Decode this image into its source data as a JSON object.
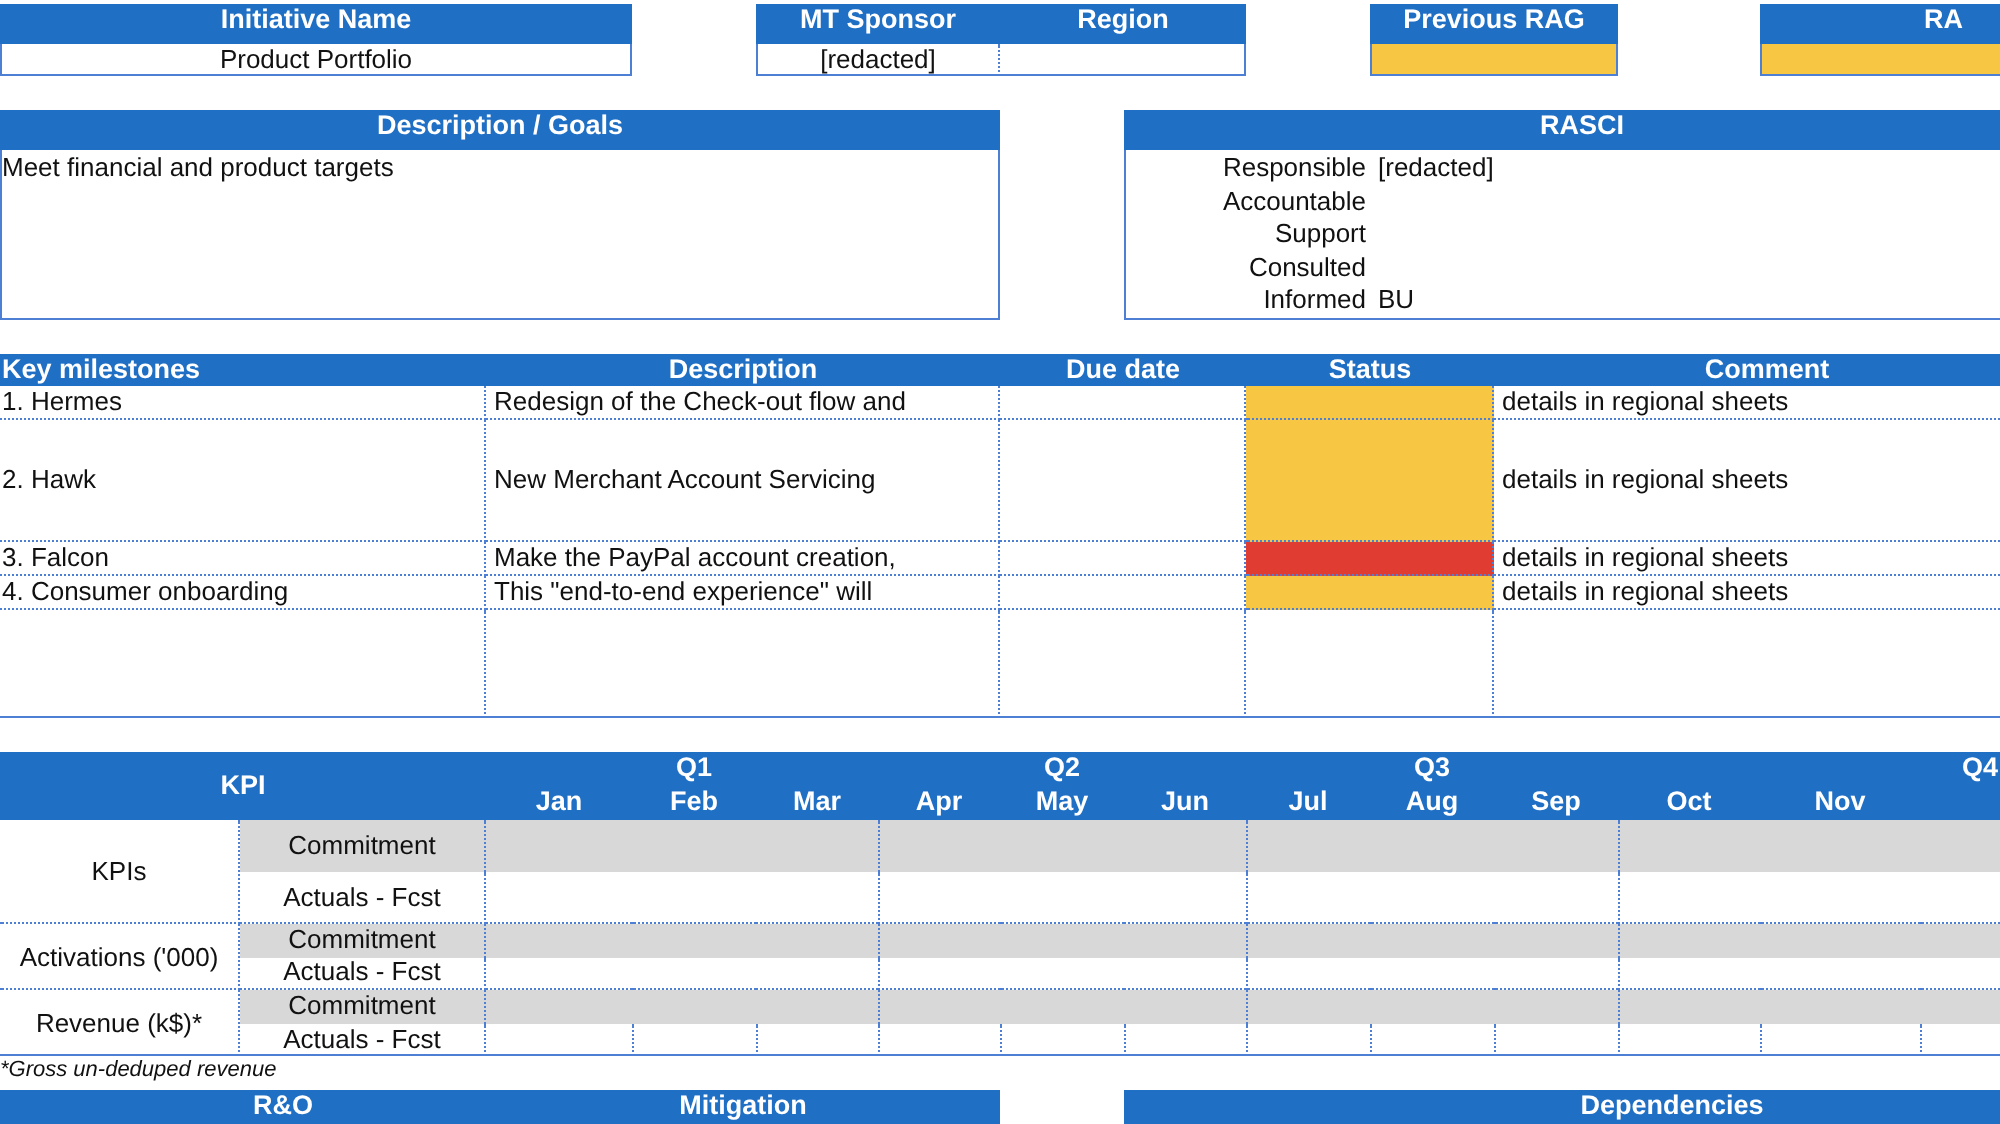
{
  "summary": {
    "initiative": {
      "header": "Initiative Name",
      "value": "Product Portfolio"
    },
    "sponsor": {
      "header": "MT Sponsor",
      "value": "[redacted]"
    },
    "region": {
      "header": "Region"
    },
    "previous_rag": {
      "header": "Previous RAG",
      "color": "#f7c744"
    },
    "rag": {
      "header": "RA",
      "color": "#f7c744"
    }
  },
  "description": {
    "header": "Description / Goals",
    "text": "Meet financial and product targets"
  },
  "rasci": {
    "header": "RASCI",
    "rows": [
      {
        "role": "Responsible",
        "value": "[redacted]"
      },
      {
        "role": "Accountable"
      },
      {
        "role": "Support"
      },
      {
        "role": "Consulted"
      },
      {
        "role": "Informed",
        "value": "BU"
      }
    ]
  },
  "milestones": {
    "columns": [
      "Key milestones",
      "Description",
      "Due date",
      "Status",
      "Comment"
    ],
    "rows": [
      {
        "name": "1. Hermes",
        "description": "Redesign of the Check-out flow and",
        "color": "#f7c744",
        "comment": "details in regional sheets"
      },
      {
        "name": "2. Hawk",
        "description": "New Merchant Account Servicing",
        "color": "#f7c744",
        "comment": "details in regional sheets"
      },
      {
        "name": "3. Falcon",
        "description": "Make the PayPal account creation,",
        "color": "#e03c31",
        "comment": "details in regional sheets"
      },
      {
        "name": "4. Consumer onboarding",
        "description": "This \"end-to-end experience\" will",
        "color": "#f7c744",
        "comment": "details in regional sheets"
      }
    ]
  },
  "kpi": {
    "header": "KPI",
    "quarters": [
      "Q1",
      "Q2",
      "Q3",
      "Q4"
    ],
    "months": [
      "Jan",
      "Feb",
      "Mar",
      "Apr",
      "May",
      "Jun",
      "Jul",
      "Aug",
      "Sep",
      "Oct",
      "Nov"
    ],
    "groups": [
      {
        "label": "KPIs",
        "rows": [
          "Commitment",
          "Actuals - Fcst"
        ]
      },
      {
        "label": "Activations ('000)",
        "rows": [
          "Commitment",
          "Actuals - Fcst"
        ]
      },
      {
        "label": "Revenue (k$)*",
        "rows": [
          "Commitment",
          "Actuals - Fcst"
        ]
      }
    ],
    "footnote": "*Gross un-deduped revenue"
  },
  "bottom": {
    "headers": [
      "R&O",
      "Mitigation",
      "Dependencies"
    ]
  }
}
